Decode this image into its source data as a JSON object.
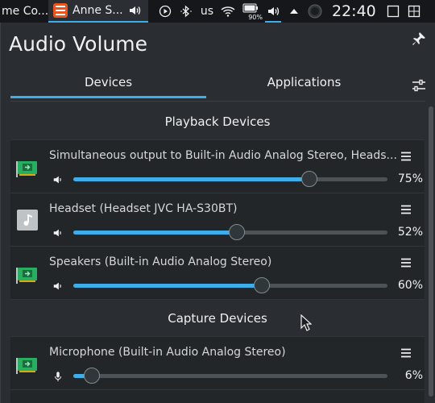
{
  "taskbar": {
    "tasks": [
      {
        "label": "me Co..."
      },
      {
        "label": "Anne S..."
      }
    ],
    "battery_percent_label": "90%",
    "keyboard_layout": "us",
    "clock": "22:40"
  },
  "popup": {
    "title": "Audio Volume",
    "tabs": [
      {
        "label": "Devices",
        "active": true
      },
      {
        "label": "Applications",
        "active": false
      }
    ],
    "playback_header": "Playback Devices",
    "capture_header": "Capture Devices",
    "playback_devices": [
      {
        "name": "Simultaneous output to Built-in Audio Analog Stereo, Heads...",
        "volume_label": "75%",
        "volume": 0.75,
        "icon": "sound-card-icon"
      },
      {
        "name": "Headset (Headset JVC HA-S30BT)",
        "volume_label": "52%",
        "volume": 0.52,
        "icon": "headset-icon"
      },
      {
        "name": "Speakers (Built-in Audio Analog Stereo)",
        "volume_label": "60%",
        "volume": 0.6,
        "icon": "sound-card-icon"
      }
    ],
    "capture_devices": [
      {
        "name": "Microphone (Built-in Audio Analog Stereo)",
        "volume_label": "6%",
        "volume": 0.06,
        "icon": "sound-card-icon"
      }
    ]
  },
  "colors": {
    "accent": "#3daee9",
    "background": "#2a2e32",
    "list_background": "#232629"
  }
}
